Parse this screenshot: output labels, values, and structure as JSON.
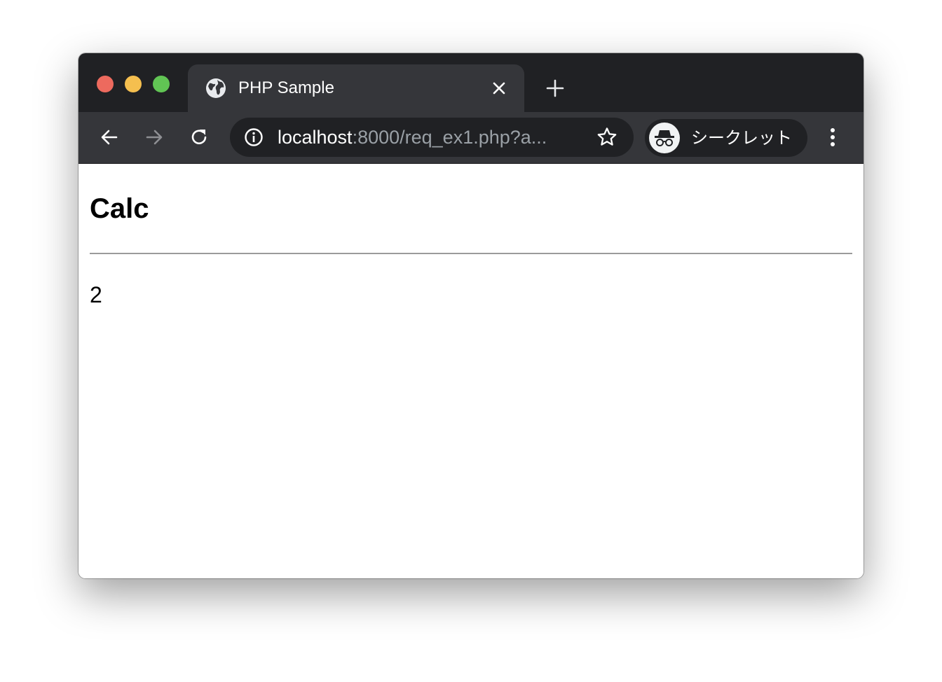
{
  "window": {
    "traffic_lights": [
      "close",
      "minimize",
      "zoom"
    ]
  },
  "tab": {
    "title": "PHP Sample",
    "favicon": "globe-icon"
  },
  "toolbar": {
    "url_host": "localhost",
    "url_rest": ":8000/req_ex1.php?a...",
    "incognito_label": "シークレット"
  },
  "page": {
    "heading": "Calc",
    "result": "2"
  },
  "colors": {
    "titlebar": "#202124",
    "toolbar": "#35363a",
    "url_dim": "#9aa0a6"
  }
}
